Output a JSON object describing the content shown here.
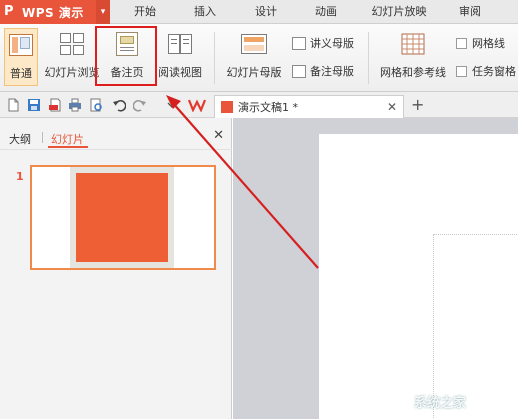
{
  "app": {
    "logo": "P",
    "title": "WPS 演示",
    "caret": "▾"
  },
  "tabs": [
    {
      "label": "开始"
    },
    {
      "label": "插入"
    },
    {
      "label": "设计"
    },
    {
      "label": "动画"
    },
    {
      "label": "幻灯片放映"
    },
    {
      "label": "审阅"
    }
  ],
  "ribbon": {
    "views": [
      {
        "label": "普通",
        "icon": "normal-view-icon",
        "selected": true
      },
      {
        "label": "幻灯片浏览",
        "icon": "slide-sorter-icon"
      },
      {
        "label": "备注页",
        "icon": "notes-page-icon"
      },
      {
        "label": "阅读视图",
        "icon": "reading-view-icon"
      }
    ],
    "master": {
      "label": "幻灯片母版",
      "icon": "slide-master-icon"
    },
    "handout_master": {
      "label": "讲义母版",
      "icon": "handout-master-icon"
    },
    "notes_master": {
      "label": "备注母版",
      "icon": "notes-master-icon"
    },
    "grid": {
      "label": "网格和参考线",
      "icon": "grid-guides-icon"
    },
    "gridlines_checkbox": {
      "label": "网格线"
    },
    "taskpane_checkbox": {
      "label": "任务窗格"
    }
  },
  "quickbar": {
    "doc_tab": {
      "title": "演示文稿1 *",
      "close": "✕"
    },
    "new_tab": "+"
  },
  "left_panel": {
    "tab_outline": "大纲",
    "tab_slides": "幻灯片",
    "close": "✕",
    "slides": [
      {
        "number": "1"
      }
    ]
  },
  "watermark": "系统之家",
  "colors": {
    "accent": "#e8553a",
    "highlight": "#e01d1d"
  }
}
